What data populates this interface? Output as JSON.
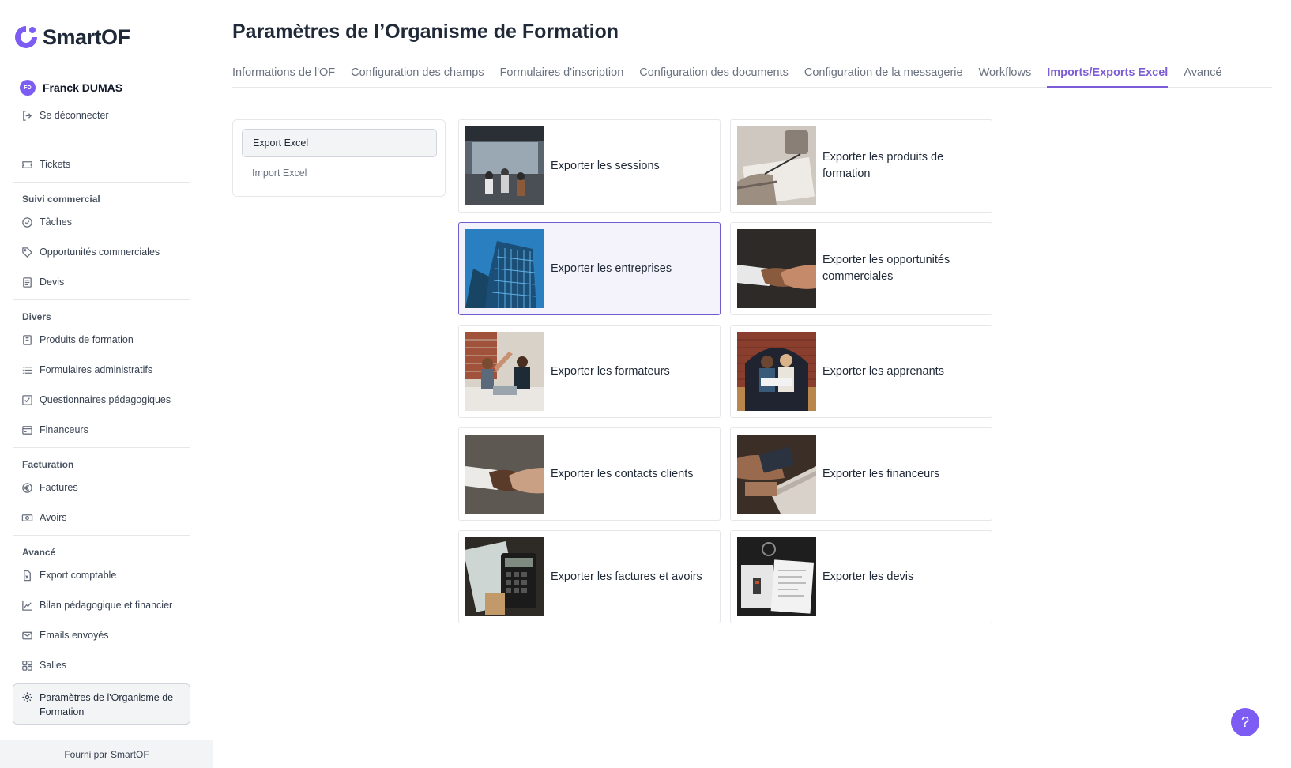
{
  "app": {
    "name": "SmartOF"
  },
  "user": {
    "initials": "FD",
    "name": "Franck DUMAS"
  },
  "sidebar": {
    "logout": "Se déconnecter",
    "tickets": "Tickets",
    "sections": {
      "suivi": "Suivi commercial",
      "divers": "Divers",
      "facturation": "Facturation",
      "avance": "Avancé"
    },
    "items": {
      "taches": "Tâches",
      "opportunites": "Opportunités commerciales",
      "devis": "Devis",
      "produits": "Produits de formation",
      "formulaires": "Formulaires administratifs",
      "questionnaires": "Questionnaires pédagogiques",
      "financeurs": "Financeurs",
      "factures": "Factures",
      "avoirs": "Avoirs",
      "export_comptable": "Export comptable",
      "bilan": "Bilan pédagogique et financier",
      "emails": "Emails envoyés",
      "salles": "Salles",
      "parametres": "Paramètres de l'Organisme de Formation"
    },
    "footer_prefix": "Fourni par",
    "footer_link": "SmartOF"
  },
  "page": {
    "title": "Paramètres de l’Organisme de Formation"
  },
  "tabs": [
    {
      "label": "Informations de l'OF"
    },
    {
      "label": "Configuration des champs"
    },
    {
      "label": "Formulaires d'inscription"
    },
    {
      "label": "Configuration des documents"
    },
    {
      "label": "Configuration de la messagerie"
    },
    {
      "label": "Workflows"
    },
    {
      "label": "Imports/Exports Excel",
      "active": true
    },
    {
      "label": "Avancé"
    }
  ],
  "subnav": {
    "export": "Export Excel",
    "import": "Import Excel"
  },
  "cards": [
    {
      "label": "Exporter les sessions"
    },
    {
      "label": "Exporter les produits de formation"
    },
    {
      "label": "Exporter les entreprises",
      "selected": true
    },
    {
      "label": "Exporter les opportunités commerciales"
    },
    {
      "label": "Exporter les formateurs"
    },
    {
      "label": "Exporter les apprenants"
    },
    {
      "label": "Exporter les contacts clients"
    },
    {
      "label": "Exporter les financeurs"
    },
    {
      "label": "Exporter les factures et avoirs"
    },
    {
      "label": "Exporter les devis"
    }
  ],
  "help": {
    "label": "?"
  },
  "colors": {
    "accent": "#7c5cf3",
    "tab_active": "#7c5cd6",
    "selected_border": "#6d5bd0"
  }
}
